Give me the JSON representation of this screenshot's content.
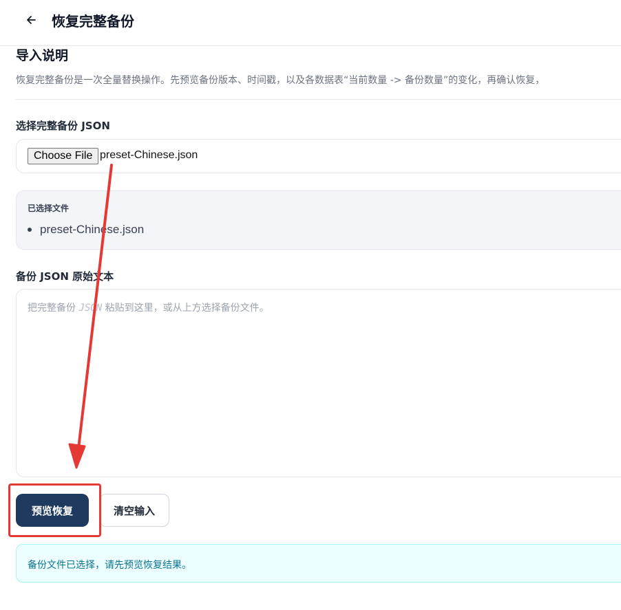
{
  "header": {
    "back_icon": "arrow-left-icon",
    "title": "恢复完整备份"
  },
  "intro": {
    "title": "导入说明",
    "description": "恢复完整备份是一次全量替换操作。先预览备份版本、时间戳，以及各数据表“当前数量 -> 备份数量”的变化，再确认恢复，"
  },
  "file_picker": {
    "label": "选择完整备份 JSON",
    "button_label": "Choose File",
    "selected_name": "preset-Chinese.json"
  },
  "selected_files": {
    "title": "已选择文件",
    "items": [
      "preset-Chinese.json"
    ]
  },
  "raw_json": {
    "label": "备份 JSON 原始文本",
    "placeholder_before": "把完整备份 ",
    "placeholder_code": "JSON",
    "placeholder_after": " 粘贴到这里，或从上方选择备份文件。",
    "value": ""
  },
  "actions": {
    "preview_label": "预览恢复",
    "clear_label": "清空输入"
  },
  "status": {
    "message": "备份文件已选择，请先预览恢复结果。"
  },
  "annotation": {
    "color": "#e53935"
  }
}
